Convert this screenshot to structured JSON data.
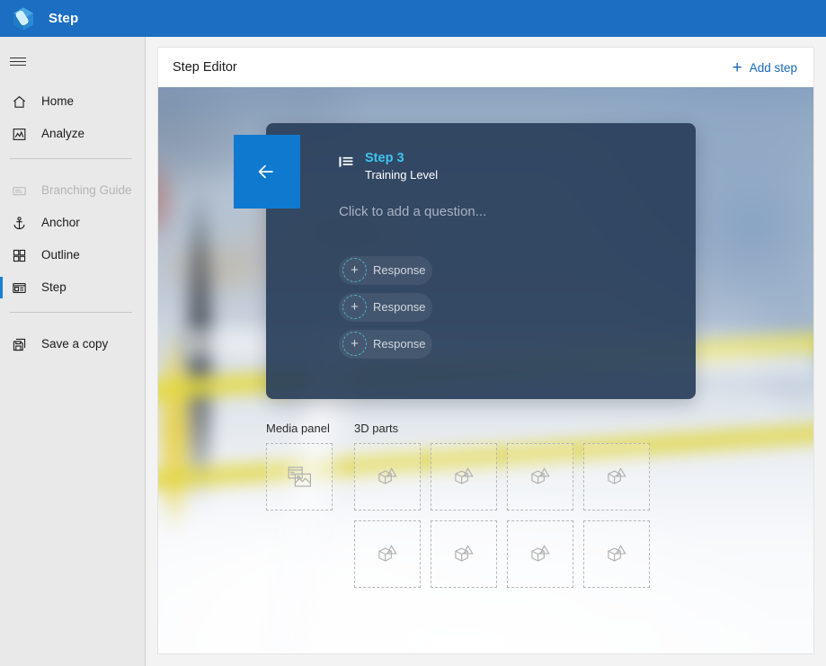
{
  "titlebar": {
    "app_name": "Step",
    "logo_icon": "hexagon-cube-logo",
    "bg_color": "#1b6ec2"
  },
  "sidebar": {
    "menu_toggle_icon": "hamburger-icon",
    "items": [
      {
        "label": "Home",
        "icon": "home-icon",
        "state": "enabled"
      },
      {
        "label": "Analyze",
        "icon": "analyze-chart-icon",
        "state": "enabled"
      },
      {
        "label": "Branching Guide",
        "icon": "branching-guide-icon",
        "state": "disabled"
      },
      {
        "label": "Anchor",
        "icon": "anchor-icon",
        "state": "enabled"
      },
      {
        "label": "Outline",
        "icon": "outline-grid-icon",
        "state": "enabled"
      },
      {
        "label": "Step",
        "icon": "step-icon",
        "state": "active"
      },
      {
        "label": "Save a copy",
        "icon": "save-copy-icon",
        "state": "enabled"
      }
    ],
    "accent_color": "#1b7fd4"
  },
  "editor": {
    "title": "Step Editor",
    "add_step_label": "Add step",
    "add_step_icon": "plus-icon",
    "add_step_color": "#1868b8"
  },
  "step_card": {
    "back_icon": "arrow-left-icon",
    "back_button_color": "#0f79d0",
    "list_icon": "list-icon",
    "step_number": "Step 3",
    "step_number_color": "#3bc5f0",
    "step_title": "Training Level",
    "question_placeholder": "Click to add a question...",
    "card_color": "#293e5a",
    "responses": [
      {
        "label": "Response",
        "icon": "plus-circle-dashed-icon"
      },
      {
        "label": "Response",
        "icon": "plus-circle-dashed-icon"
      },
      {
        "label": "Response",
        "icon": "plus-circle-dashed-icon"
      }
    ]
  },
  "drop_zones": {
    "media_panel": {
      "title": "Media panel",
      "slots": [
        {
          "icon": "media-image-icon"
        }
      ]
    },
    "parts_3d": {
      "title": "3D parts",
      "slots": [
        {
          "icon": "3d-part-icon"
        },
        {
          "icon": "3d-part-icon"
        },
        {
          "icon": "3d-part-icon"
        },
        {
          "icon": "3d-part-icon"
        },
        {
          "icon": "3d-part-icon"
        },
        {
          "icon": "3d-part-icon"
        },
        {
          "icon": "3d-part-icon"
        },
        {
          "icon": "3d-part-icon"
        }
      ]
    }
  }
}
